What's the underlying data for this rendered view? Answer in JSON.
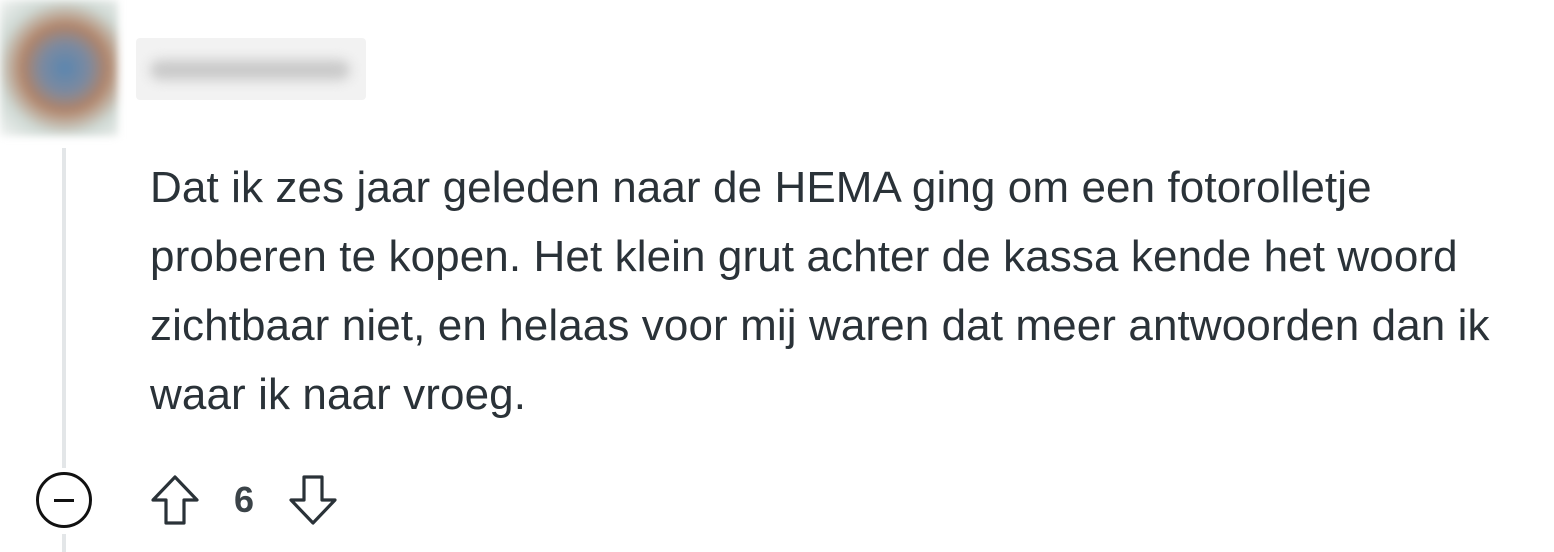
{
  "comment": {
    "author_avatar_icon": "avatar-blurred",
    "username": "",
    "body": "Dat ik zes jaar geleden naar de HEMA ging om een fotorolletje proberen te kopen. Het klein grut achter de kassa kende het woord zichtbaar niet, en helaas voor mij waren dat meer antwoorden dan ik waar ik naar vroeg.",
    "score": "6"
  },
  "actions": {
    "collapse_icon": "minus-circle-icon",
    "upvote_icon": "arrow-up-icon",
    "downvote_icon": "arrow-down-icon"
  },
  "colors": {
    "text": "#2a3238",
    "thread_line": "#e3e6e8",
    "icon": "#111111"
  }
}
